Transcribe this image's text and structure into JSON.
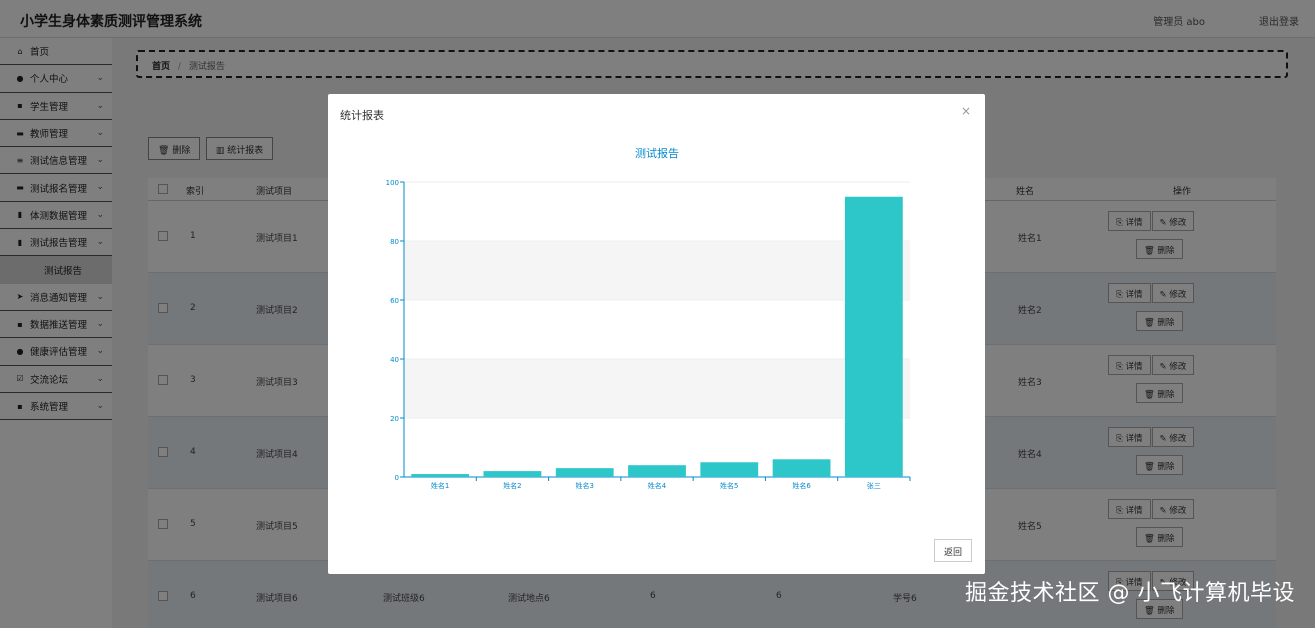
{
  "header": {
    "title": "小学生身体素质测评管理系统",
    "user": "管理员 abo",
    "logout": "退出登录"
  },
  "sidebar": {
    "items": [
      {
        "label": "首页",
        "icon": "home-icon",
        "glyph": "⌂"
      },
      {
        "label": "个人中心",
        "icon": "user-icon",
        "glyph": "●"
      },
      {
        "label": "学生管理",
        "icon": "grid-icon",
        "glyph": "▪"
      },
      {
        "label": "教师管理",
        "icon": "monitor-icon",
        "glyph": "▬"
      },
      {
        "label": "测试信息管理",
        "icon": "list-icon",
        "glyph": "≡"
      },
      {
        "label": "测试报名管理",
        "icon": "monitor-icon",
        "glyph": "▬"
      },
      {
        "label": "体测数据管理",
        "icon": "lock-icon",
        "glyph": "▮"
      },
      {
        "label": "测试报告管理",
        "icon": "lock-icon",
        "glyph": "▮"
      },
      {
        "label": "测试报告",
        "icon": "",
        "glyph": "",
        "active": true
      },
      {
        "label": "消息通知管理",
        "icon": "send-icon",
        "glyph": "➤"
      },
      {
        "label": "数据推送管理",
        "icon": "grid-icon",
        "glyph": "▪"
      },
      {
        "label": "健康评估管理",
        "icon": "user-icon",
        "glyph": "●"
      },
      {
        "label": "交流论坛",
        "icon": "check-icon",
        "glyph": "☑"
      },
      {
        "label": "系统管理",
        "icon": "grid-icon",
        "glyph": "▪"
      }
    ]
  },
  "breadcrumb": {
    "home": "首页",
    "separator": "/",
    "current": "测试报告"
  },
  "toolbar": {
    "delete_label": "删除",
    "stats_label": "统计报表",
    "delete_icon": "trash-icon",
    "stats_icon": "bar-chart-icon"
  },
  "table": {
    "headers": {
      "index": "索引",
      "project": "测试项目",
      "name": "姓名",
      "ops": "操作"
    },
    "rows": [
      {
        "index": "1",
        "project": "测试项目1",
        "name": "姓名1"
      },
      {
        "index": "2",
        "project": "测试项目2",
        "name": "姓名2"
      },
      {
        "index": "3",
        "project": "测试项目3",
        "name": "姓名3"
      },
      {
        "index": "4",
        "project": "测试项目4",
        "name": "姓名4"
      },
      {
        "index": "5",
        "project": "测试项目5",
        "name": "姓名5"
      },
      {
        "index": "6",
        "project": "测试项目6",
        "name": "",
        "class": "测试班级6",
        "place": "测试地点6",
        "v1": "6",
        "v2": "6",
        "sid": "学号6"
      }
    ],
    "detail_label": "详情",
    "edit_label": "修改",
    "delete_label": "删除"
  },
  "modal": {
    "title": "统计报表",
    "close_glyph": "×",
    "back_label": "返回"
  },
  "chart_data": {
    "type": "bar",
    "title": "测试报告",
    "categories": [
      "姓名1",
      "姓名2",
      "姓名3",
      "姓名4",
      "姓名5",
      "姓名6",
      "张三"
    ],
    "values": [
      1,
      2,
      3,
      4,
      5,
      6,
      95
    ],
    "ylim": [
      0,
      100
    ],
    "yticks": [
      0,
      20,
      40,
      60,
      80,
      100
    ],
    "bar_color": "#2ec7c9",
    "axis_color": "#008acd",
    "title_color": "#008acd"
  },
  "watermark": "掘金技术社区 @ 小飞计算机毕设"
}
